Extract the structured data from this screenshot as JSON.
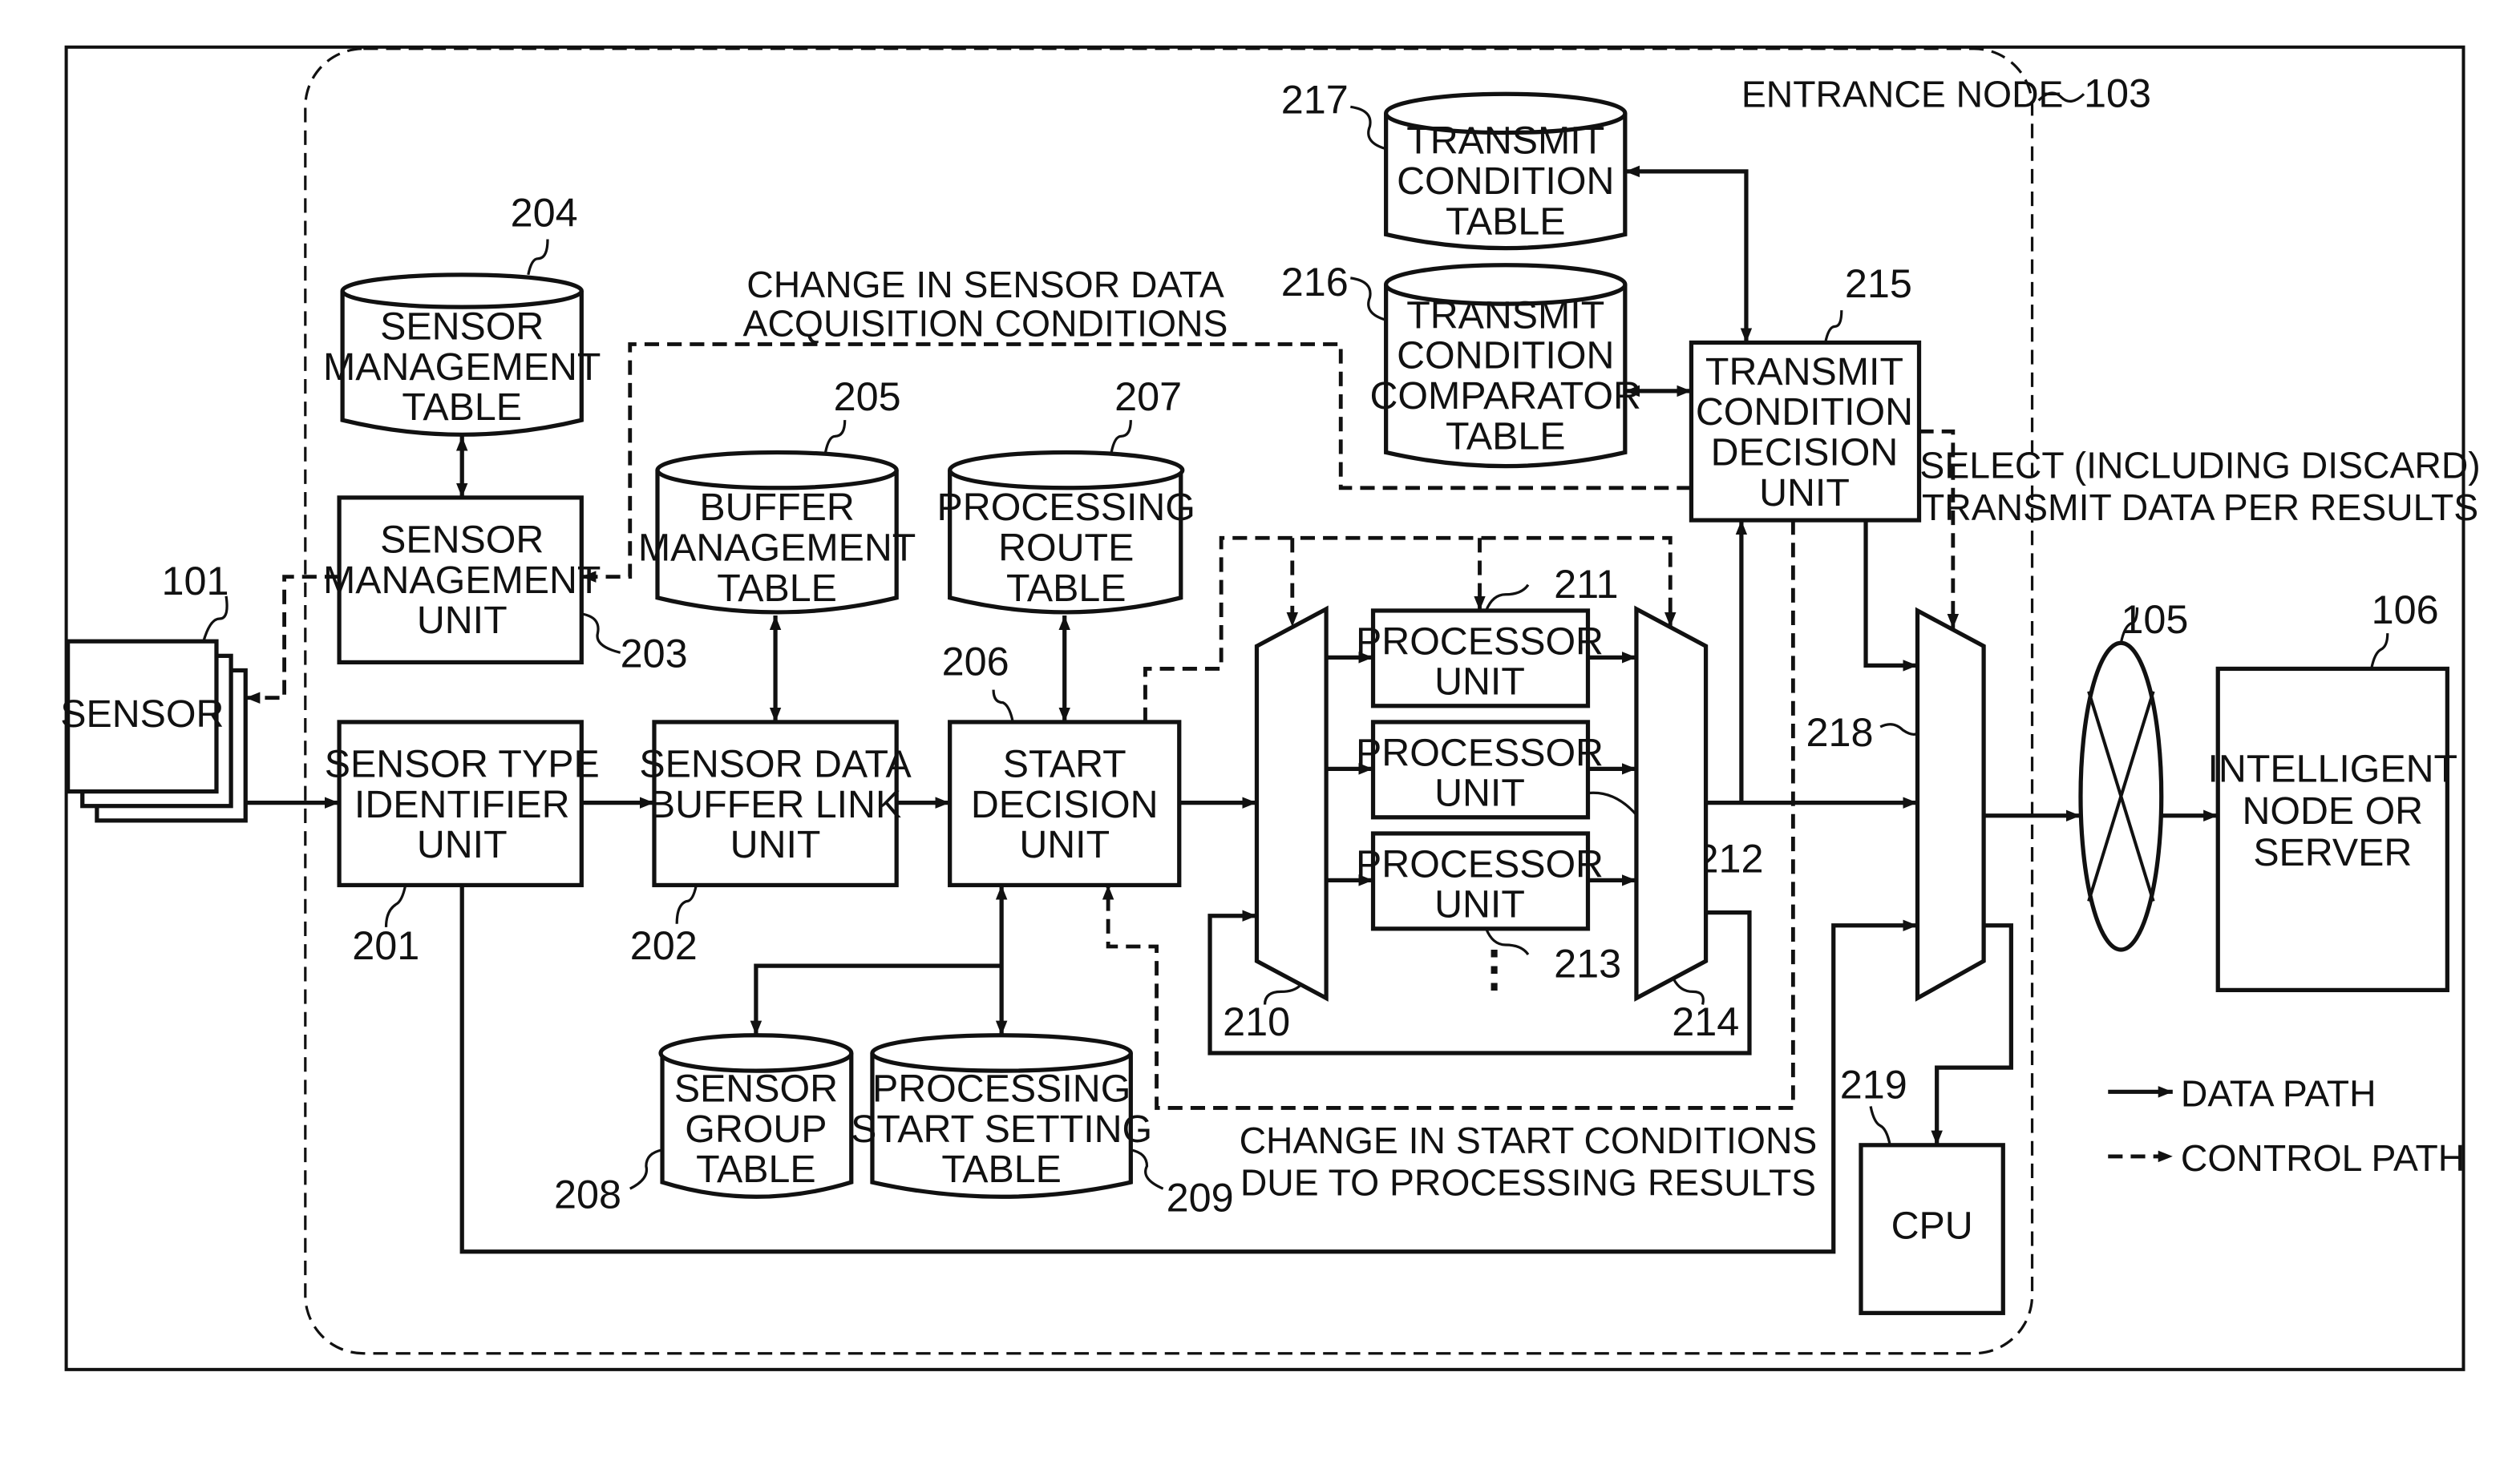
{
  "figure": {
    "entrance_node": {
      "label": "ENTRANCE NODE",
      "ref": "103"
    },
    "sensor": {
      "label": "SENSOR",
      "ref": "101"
    },
    "network": {
      "ref": "105"
    },
    "server": {
      "lines": [
        "INTELLIGENT",
        "NODE OR",
        "SERVER"
      ],
      "ref": "106"
    },
    "units": {
      "sensor_type_identifier": {
        "lines": [
          "SENSOR TYPE",
          "IDENTIFIER",
          "UNIT"
        ],
        "ref": "201"
      },
      "sensor_data_buffer_link": {
        "lines": [
          "SENSOR DATA",
          "BUFFER LINK",
          "UNIT"
        ],
        "ref": "202"
      },
      "sensor_management_unit": {
        "lines": [
          "SENSOR",
          "MANAGEMENT",
          "UNIT"
        ],
        "ref": "203"
      },
      "start_decision": {
        "lines": [
          "START",
          "DECISION",
          "UNIT"
        ],
        "ref": "206"
      },
      "transmit_condition_decision": {
        "lines": [
          "TRANSMIT",
          "CONDITION",
          "DECISION",
          "UNIT"
        ],
        "ref": "215"
      },
      "cpu": {
        "lines": [
          "CPU"
        ],
        "ref": "219"
      },
      "processor_1": {
        "lines": [
          "PROCESSOR",
          "UNIT"
        ],
        "ref": "211"
      },
      "processor_2": {
        "lines": [
          "PROCESSOR",
          "UNIT"
        ],
        "ref": "212"
      },
      "processor_3": {
        "lines": [
          "PROCESSOR",
          "UNIT"
        ],
        "ref": "213"
      },
      "demux_in": {
        "ref": "210"
      },
      "mux_out": {
        "ref": "214"
      },
      "selector": {
        "ref": "218"
      }
    },
    "tables": {
      "sensor_management_table": {
        "lines": [
          "SENSOR",
          "MANAGEMENT",
          "TABLE"
        ],
        "ref": "204"
      },
      "buffer_management_table": {
        "lines": [
          "BUFFER",
          "MANAGEMENT",
          "TABLE"
        ],
        "ref": "205"
      },
      "processing_route_table": {
        "lines": [
          "PROCESSING",
          "ROUTE",
          "TABLE"
        ],
        "ref": "207"
      },
      "sensor_group_table": {
        "lines": [
          "SENSOR",
          "GROUP",
          "TABLE"
        ],
        "ref": "208"
      },
      "processing_start_setting_table": {
        "lines": [
          "PROCESSING",
          "START SETTING",
          "TABLE"
        ],
        "ref": "209"
      },
      "transmit_condition_comparator_table": {
        "lines": [
          "TRANSMIT",
          "CONDITION",
          "COMPARATOR",
          "TABLE"
        ],
        "ref": "216"
      },
      "transmit_condition_table": {
        "lines": [
          "TRANSMIT",
          "CONDITION",
          "TABLE"
        ],
        "ref": "217"
      }
    },
    "annotations": {
      "sensor_acq_change": [
        "CHANGE IN SENSOR DATA",
        "ACQUISITION CONDITIONS"
      ],
      "start_cond_change": [
        "CHANGE IN START CONDITIONS",
        "DUE TO PROCESSING RESULTS"
      ],
      "select_transmit": [
        "SELECT (INCLUDING DISCARD)",
        "TRANSMIT DATA PER RESULTS"
      ],
      "ellipsis": "⋮"
    },
    "legend": {
      "data_path": "DATA PATH",
      "control_path": "CONTROL PATH"
    }
  }
}
